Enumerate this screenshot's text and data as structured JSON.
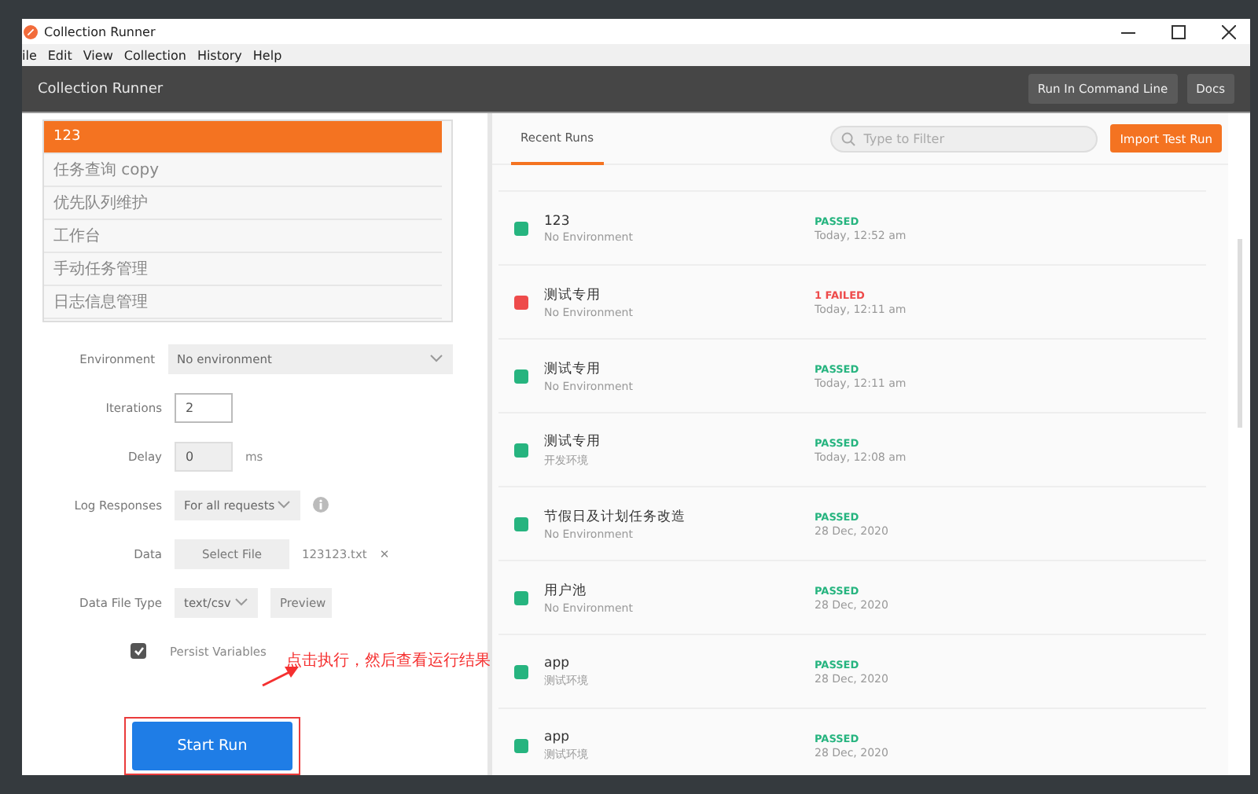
{
  "window": {
    "title": "Collection Runner"
  },
  "menu": [
    "ile",
    "Edit",
    "View",
    "Collection",
    "History",
    "Help"
  ],
  "header": {
    "title": "Collection Runner",
    "buttons": [
      "Run In Command Line",
      "Docs"
    ]
  },
  "collections": [
    {
      "label": "123",
      "selected": true
    },
    {
      "label": "任务查询 copy",
      "selected": false
    },
    {
      "label": "优先队列维护",
      "selected": false
    },
    {
      "label": "工作台",
      "selected": false
    },
    {
      "label": "手动任务管理",
      "selected": false
    },
    {
      "label": "日志信息管理",
      "selected": false
    }
  ],
  "form": [
    {
      "kind": "select",
      "label": "Environment",
      "value": "No environment",
      "wide": true,
      "info": false
    },
    {
      "kind": "input",
      "label": "Iterations",
      "value": "2",
      "focused": true
    },
    {
      "kind": "input",
      "label": "Delay",
      "value": "0",
      "unit": "ms",
      "focused": false
    },
    {
      "kind": "select",
      "label": "Log Responses",
      "value": "For all requests",
      "wide": false,
      "info": true
    },
    {
      "kind": "file",
      "label": "Data",
      "button": "Select File",
      "file": "123123.txt",
      "remove": "✕"
    },
    {
      "kind": "select-preview",
      "label": "Data File Type",
      "value": "text/csv",
      "button": "Preview"
    },
    {
      "kind": "checkbox",
      "label": "Persist Variables",
      "checked": true
    }
  ],
  "start_button": "Start Run",
  "annotation": "点击执行，然后查看运行结果",
  "tabs": [
    {
      "label": "Recent Runs",
      "selected": true
    }
  ],
  "search": {
    "placeholder": "Type to Filter"
  },
  "import_button": "Import Test Run",
  "runs": [
    {
      "name": "123",
      "env": "No Environment",
      "status": "PASSED",
      "time": "Today, 12:52 am",
      "color": "#26b47f"
    },
    {
      "name": "测试专用",
      "env": "No Environment",
      "status": "1 FAILED",
      "time": "Today, 12:11 am",
      "color": "#ee4b4b"
    },
    {
      "name": "测试专用",
      "env": "No Environment",
      "status": "PASSED",
      "time": "Today, 12:11 am",
      "color": "#26b47f"
    },
    {
      "name": "测试专用",
      "env": "开发环境",
      "status": "PASSED",
      "time": "Today, 12:08 am",
      "color": "#26b47f"
    },
    {
      "name": "节假日及计划任务改造",
      "env": "No Environment",
      "status": "PASSED",
      "time": "28 Dec, 2020",
      "color": "#26b47f"
    },
    {
      "name": "用户池",
      "env": "No Environment",
      "status": "PASSED",
      "time": "28 Dec, 2020",
      "color": "#26b47f"
    },
    {
      "name": "app",
      "env": "测试环境",
      "status": "PASSED",
      "time": "28 Dec, 2020",
      "color": "#26b47f"
    },
    {
      "name": "app",
      "env": "测试环境",
      "status": "PASSED",
      "time": "28 Dec, 2020",
      "color": "#26b47f"
    }
  ]
}
